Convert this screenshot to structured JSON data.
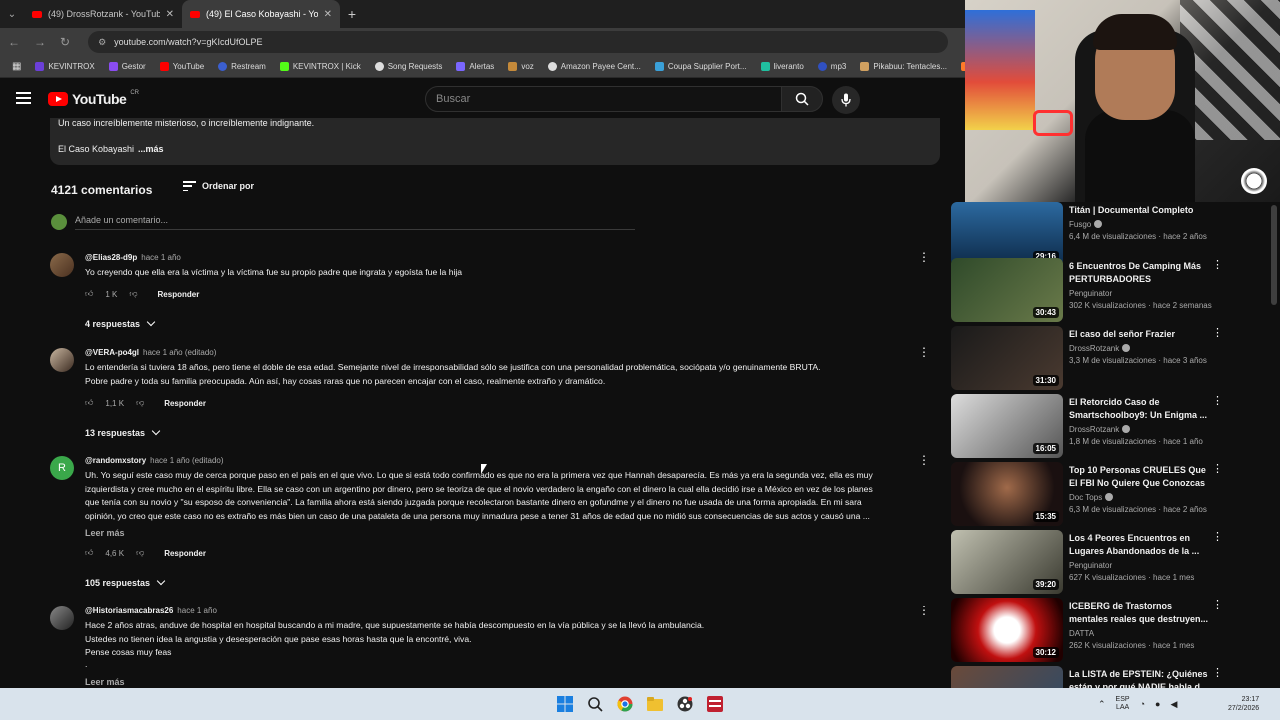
{
  "browser": {
    "tabs": [
      {
        "title": "(49) DrossRotzank - YouTube",
        "active": false
      },
      {
        "title": "(49) El Caso Kobayashi - YouTub",
        "active": true
      }
    ],
    "url": "youtube.com/watch?v=gKIcdUfOLPE",
    "bookmarks": [
      "KEVINTROX",
      "Gestor",
      "YouTube",
      "Restream",
      "KEVINTROX | Kick",
      "Song Requests",
      "Alertas",
      "voz",
      "Amazon Payee Cent...",
      "Coupa Supplier Port...",
      "liveranto",
      "mp3",
      "Pikabuu: Tentacles...",
      "com"
    ]
  },
  "header": {
    "logo_text": "YouTube",
    "country": "CR",
    "search_placeholder": "Buscar"
  },
  "description": {
    "line1": "Un caso increíblemente misterioso, o increíblemente indignante.",
    "line2": "El Caso Kobayashi",
    "more": "...más"
  },
  "comments_section": {
    "count_label": "4121 comentarios",
    "sort_label": "Ordenar por",
    "add_placeholder": "Añade un comentario...",
    "reply_label": "Responder",
    "comments": [
      {
        "author": "@Elias28-d9p",
        "time": "hace 1 año",
        "lines": [
          "Yo creyendo que ella era la víctima y la víctima fue su propio padre que ingrata y egoísta fue la hija"
        ],
        "likes": "1 K",
        "replies": "4 respuestas",
        "read_more": ""
      },
      {
        "author": "@VERA-po4gl",
        "time": "hace 1 año (editado)",
        "lines": [
          "Lo entendería si tuviera 18 años, pero tiene el doble de esa edad. Semejante nivel de irresponsabilidad sólo se justifica con una personalidad problemática, sociópata y/o genuinamente BRUTA.",
          "Pobre padre y toda su familia preocupada. Aún así, hay cosas raras que no parecen encajar con el caso, realmente extraño y dramático."
        ],
        "likes": "1,1 K",
        "replies": "13 respuestas",
        "read_more": ""
      },
      {
        "author": "@randomxstory",
        "time": "hace 1 año (editado)",
        "avatar_letter": "R",
        "lines": [
          "Uh. Yo seguí este caso muy de cerca porque paso en el país en el que vivo. Lo que si está todo confirmado es que no era la primera vez que Hannah desaparecía. Es más ya era la segunda vez, ella es muy",
          "izquierdista y cree mucho en el espíritu libre. Ella se caso con un argentino por dinero, pero se teoriza de que el novio verdadero la engaño con el dinero la cual ella decidió irse a México en vez de los planes",
          "que tenía con su novio y \"su esposo de conveniencia\".  La familia ahora está siendo juzgada porque recolectaron bastante dinero en gofundme y el dinero no fue usada de una forma apropiada. En mi sara",
          "opinión, yo creo que este caso no es extraño es más bien un caso de una pataleta de una persona muy inmadura pese a tener 31 años de edad que no midió sus consecuencias de sus actos y causó una ..."
        ],
        "likes": "4,6 K",
        "replies": "105 respuestas",
        "read_more": "Leer más"
      },
      {
        "author": "@Historiasmacabras26",
        "time": "hace 1 año",
        "lines": [
          "Hace 2 años atras, anduve de hospital en hospital buscando a mi madre, que supuestamente se había descompuesto en la vía pública y se la llevó la ambulancia.",
          "Ustedes no tienen idea la angustia y desesperación que pase esas horas hasta que la encontré, viva.",
          "Pense cosas muy feas",
          "."
        ],
        "likes": "",
        "replies": "",
        "read_more": "Leer más"
      }
    ]
  },
  "sidebar": {
    "videos": [
      {
        "title": "Titán | Documental Completo",
        "channel": "Fusgo",
        "stats": "6,4 M de visualizaciones · hace 2 años",
        "duration": "29:16",
        "verified": true
      },
      {
        "title": "6 Encuentros De Camping Más PERTURBADORES",
        "channel": "Penguinator",
        "stats": "302 K visualizaciones · hace 2 semanas",
        "duration": "30:43",
        "verified": false
      },
      {
        "title": "El caso del señor Frazier",
        "channel": "DrossRotzank",
        "stats": "3,3 M de visualizaciones · hace 3 años",
        "duration": "31:30",
        "verified": true
      },
      {
        "title": "El Retorcido Caso de Smartschoolboy9: Un Enigma ...",
        "channel": "DrossRotzank",
        "stats": "1,8 M de visualizaciones · hace 1 año",
        "duration": "16:05",
        "verified": true
      },
      {
        "title": "Top 10 Personas CRUELES Que El FBI No Quiere Que Conozcas",
        "channel": "Doc Tops",
        "stats": "6,3 M de visualizaciones · hace 2 años",
        "duration": "15:35",
        "verified": true
      },
      {
        "title": "Los 4 Peores Encuentros en Lugares Abandonados de la ...",
        "channel": "Penguinator",
        "stats": "627 K visualizaciones · hace 1 mes",
        "duration": "39:20",
        "verified": false
      },
      {
        "title": "ICEBERG de Trastornos mentales reales que destruyen...",
        "channel": "DATTA",
        "stats": "262 K visualizaciones · hace 1 mes",
        "duration": "30:12",
        "verified": false
      },
      {
        "title": "La LISTA de EPSTEIN: ¿Quiénes están y por qué NADIE habla d...",
        "channel": "",
        "stats": "",
        "duration": "",
        "verified": false
      }
    ]
  },
  "taskbar": {
    "lang": "ESP",
    "lang2": "LAA",
    "time": "23:17",
    "date": "27/2/2026"
  },
  "colors": {
    "background": "#0f0f0f",
    "youtube_red": "#ff0000",
    "muted_text": "#aaaaaa"
  }
}
